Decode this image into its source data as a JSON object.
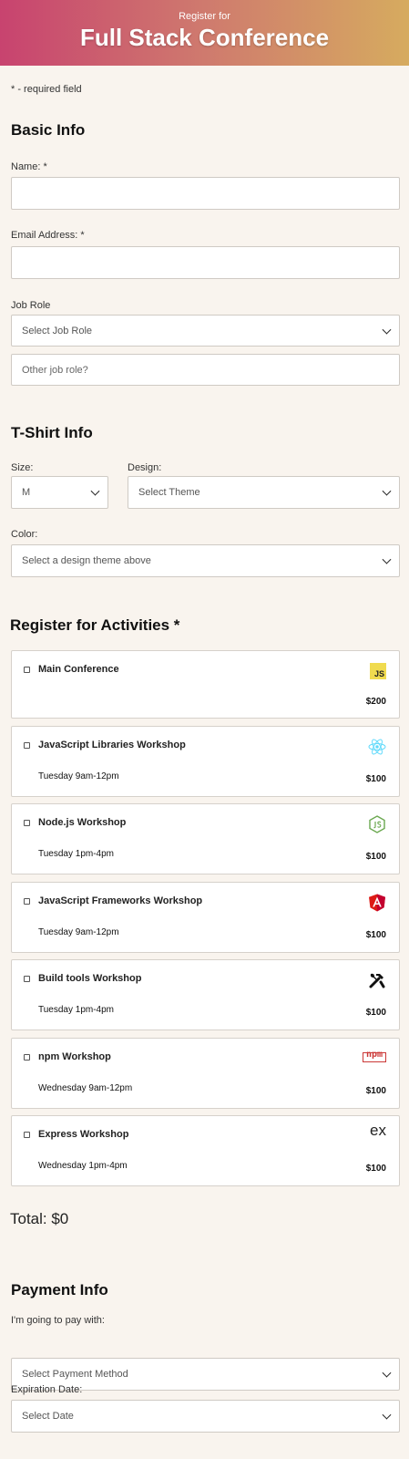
{
  "header": {
    "subtitle": "Register for",
    "title": "Full Stack Conference"
  },
  "required_note": "* - required field",
  "basic_info": {
    "heading": "Basic Info",
    "name_label": "Name: *",
    "name_value": "",
    "email_label": "Email Address: *",
    "email_value": "",
    "job_role_label": "Job Role",
    "job_role_selected": "Select Job Role",
    "other_job_placeholder": "Other job role?"
  },
  "tshirt": {
    "heading": "T-Shirt Info",
    "size_label": "Size:",
    "size_selected": "M",
    "design_label": "Design:",
    "design_selected": "Select Theme",
    "color_label": "Color:",
    "color_selected": "Select a design theme above"
  },
  "activities": {
    "heading": "Register for Activities *",
    "items": [
      {
        "name": "Main Conference",
        "time": "",
        "price": "$200",
        "icon": "js-icon",
        "checked": false
      },
      {
        "name": "JavaScript Libraries Workshop",
        "time": "Tuesday 9am-12pm",
        "price": "$100",
        "icon": "react-icon",
        "checked": false
      },
      {
        "name": "Node.js Workshop",
        "time": "Tuesday 1pm-4pm",
        "price": "$100",
        "icon": "nodejs-icon",
        "checked": false
      },
      {
        "name": "JavaScript Frameworks Workshop",
        "time": "Tuesday 9am-12pm",
        "price": "$100",
        "icon": "angular-icon",
        "checked": false
      },
      {
        "name": "Build tools Workshop",
        "time": "Tuesday 1pm-4pm",
        "price": "$100",
        "icon": "tools-icon",
        "checked": false
      },
      {
        "name": "npm Workshop",
        "time": "Wednesday 9am-12pm",
        "price": "$100",
        "icon": "npm-icon",
        "checked": false
      },
      {
        "name": "Express Workshop",
        "time": "Wednesday 1pm-4pm",
        "price": "$100",
        "icon": "express-icon",
        "checked": false
      }
    ],
    "icon_text": {
      "js": "JS",
      "npm": "npm",
      "express": "ex"
    }
  },
  "total": "Total: $0",
  "payment": {
    "heading": "Payment Info",
    "method_label": "I'm going to pay with:",
    "method_selected": "Select Payment Method",
    "expiration_label": "Expiration Date:",
    "expiration_selected": "Select Date"
  },
  "colors": {
    "header_gradient_start": "#c8436f",
    "header_gradient_end": "#d6ab5f",
    "background": "#f9f4ee",
    "js": "#f0db4f",
    "react": "#61dafb",
    "node": "#6aa84f",
    "angular": "#dd1b16",
    "npm": "#cb3837"
  }
}
